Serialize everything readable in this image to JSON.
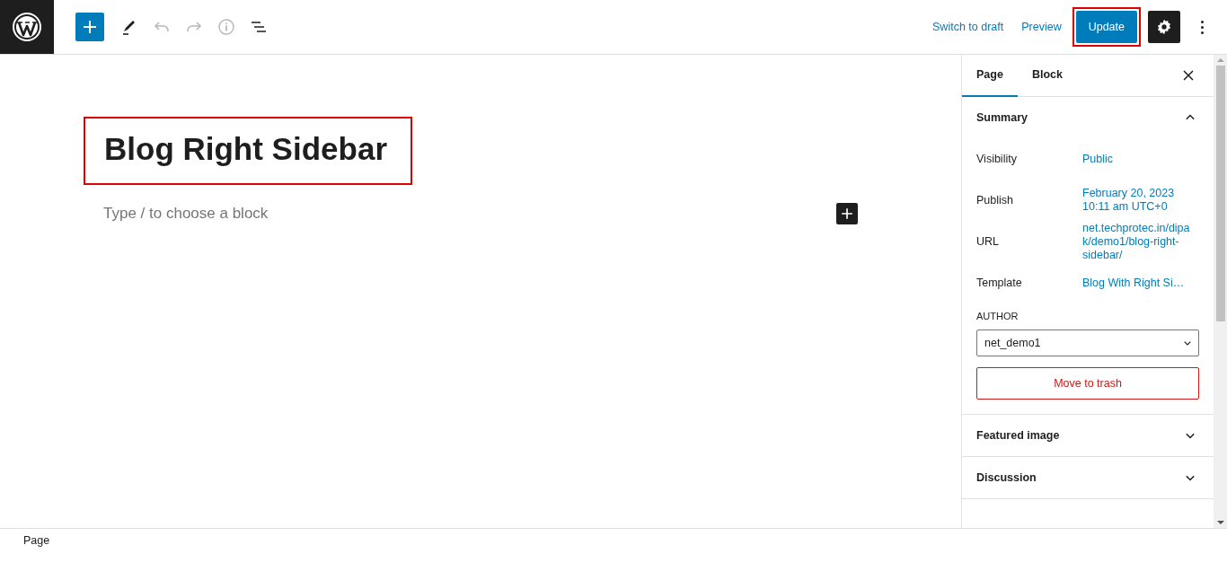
{
  "toolbar": {
    "tools": [
      {
        "kind": "add",
        "disabled": false
      },
      {
        "kind": "edit",
        "disabled": false
      },
      {
        "kind": "undo",
        "disabled": true
      },
      {
        "kind": "redo",
        "disabled": true
      },
      {
        "kind": "info",
        "disabled": true
      },
      {
        "kind": "outline",
        "disabled": false
      }
    ],
    "actions": [
      {
        "label": "Switch to draft"
      },
      {
        "label": "Preview"
      }
    ],
    "update": {
      "label": "Update",
      "highlighted": true
    },
    "settings": {
      "pressed": true
    }
  },
  "editor": {
    "title": "Blog Right Sidebar",
    "title_highlighted": true,
    "block_placeholder": "Type / to choose a block"
  },
  "sidebar": {
    "tabs": [
      {
        "label": "Page",
        "selected": true
      },
      {
        "label": "Block",
        "selected": false
      }
    ],
    "summary": {
      "title": "Summary",
      "expanded": true,
      "rows": [
        {
          "label": "Visibility",
          "value": "Public"
        },
        {
          "label": "Publish",
          "value": "February 20, 2023 10:11 am UTC+0"
        },
        {
          "label": "URL",
          "value": "net.techprotec.in/dipak/demo1/blog-right-sidebar/"
        },
        {
          "label": "Template",
          "value": "Blog With Right Si…"
        }
      ],
      "author_label": "AUTHOR",
      "author": "net_demo1",
      "trash": "Move to trash"
    },
    "panels": [
      {
        "title": "Featured image",
        "expanded": false
      },
      {
        "title": "Discussion",
        "expanded": false
      }
    ]
  },
  "status_bar": {
    "breadcrumb": "Page"
  }
}
